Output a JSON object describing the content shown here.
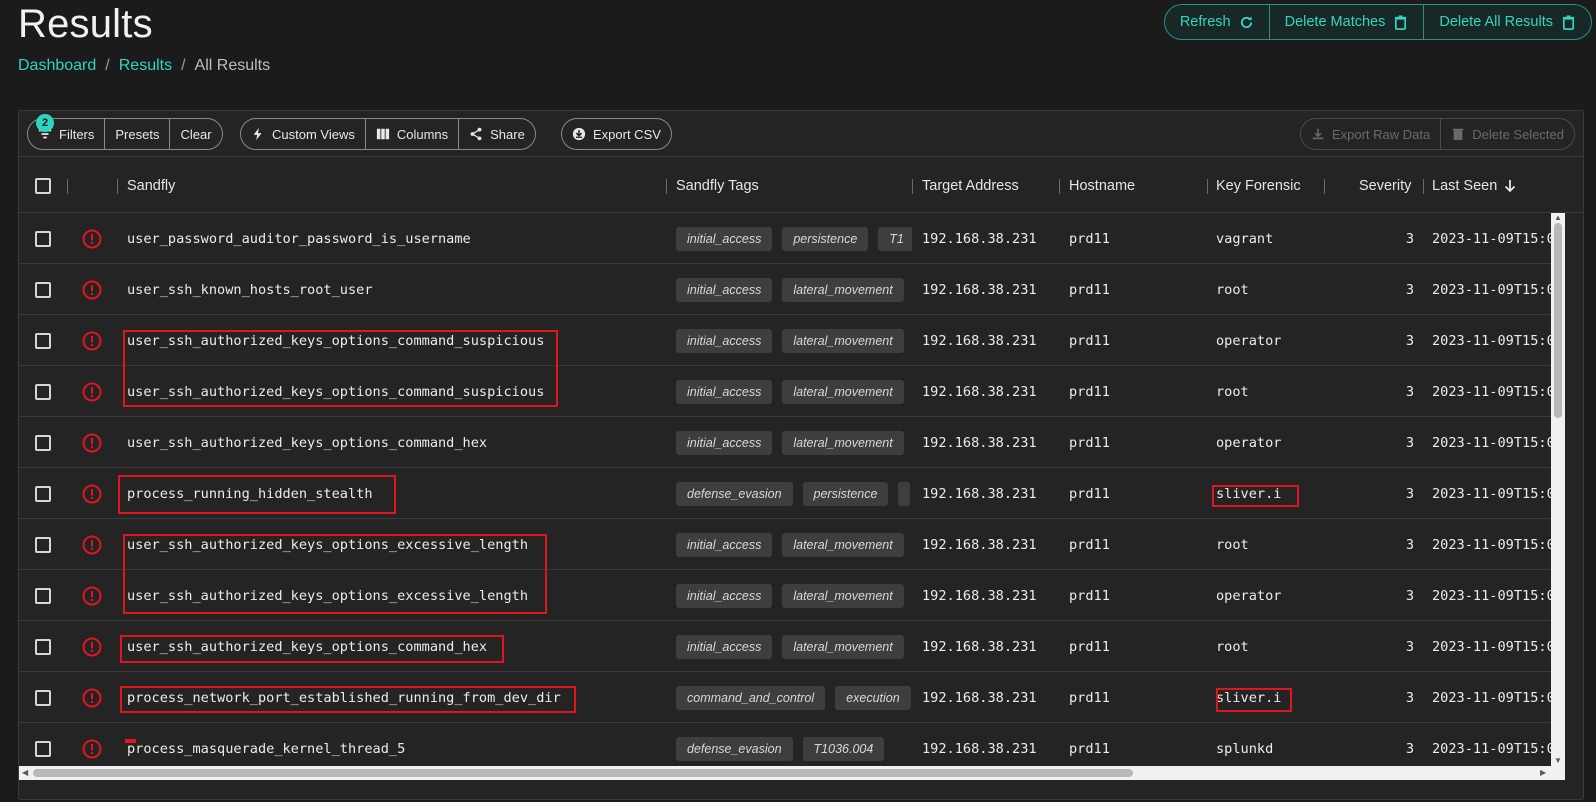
{
  "page": {
    "title": "Results"
  },
  "breadcrumb": [
    {
      "label": "Dashboard"
    },
    {
      "label": "Results"
    },
    {
      "label": "All Results"
    }
  ],
  "breadcrumb_sep": "/",
  "top_actions": {
    "refresh": "Refresh",
    "delete_matches": "Delete Matches",
    "delete_all": "Delete All Results"
  },
  "toolbar": {
    "filters": "Filters",
    "filters_badge": "2",
    "presets": "Presets",
    "clear": "Clear",
    "custom_views": "Custom Views",
    "columns": "Columns",
    "share": "Share",
    "export_csv": "Export CSV",
    "export_raw": "Export Raw Data",
    "delete_selected": "Delete Selected"
  },
  "columns": {
    "sandfly": "Sandfly",
    "tags": "Sandfly Tags",
    "target": "Target Address",
    "hostname": "Hostname",
    "key_forensic": "Key Forensic",
    "severity": "Severity",
    "last_seen": "Last Seen"
  },
  "colors": {
    "accent": "#2fd4be",
    "alert": "#e0161f",
    "highlight": "#e0161f"
  },
  "rows": [
    {
      "sandfly": "user_password_auditor_password_is_username",
      "tags": [
        "initial_access",
        "persistence",
        "T1"
      ],
      "target": "192.168.38.231",
      "hostname": "prd11",
      "forensic": "vagrant",
      "severity": "3",
      "last_seen": "2023-11-09T15:0"
    },
    {
      "sandfly": "user_ssh_known_hosts_root_user",
      "tags": [
        "initial_access",
        "lateral_movement"
      ],
      "target": "192.168.38.231",
      "hostname": "prd11",
      "forensic": "root",
      "severity": "3",
      "last_seen": "2023-11-09T15:0"
    },
    {
      "sandfly": "user_ssh_authorized_keys_options_command_suspicious",
      "tags": [
        "initial_access",
        "lateral_movement"
      ],
      "target": "192.168.38.231",
      "hostname": "prd11",
      "forensic": "operator",
      "severity": "3",
      "last_seen": "2023-11-09T15:0"
    },
    {
      "sandfly": "user_ssh_authorized_keys_options_command_suspicious",
      "tags": [
        "initial_access",
        "lateral_movement"
      ],
      "target": "192.168.38.231",
      "hostname": "prd11",
      "forensic": "root",
      "severity": "3",
      "last_seen": "2023-11-09T15:0"
    },
    {
      "sandfly": "user_ssh_authorized_keys_options_command_hex",
      "tags": [
        "initial_access",
        "lateral_movement"
      ],
      "target": "192.168.38.231",
      "hostname": "prd11",
      "forensic": "operator",
      "severity": "3",
      "last_seen": "2023-11-09T15:0"
    },
    {
      "sandfly": "process_running_hidden_stealth",
      "tags": [
        "defense_evasion",
        "persistence",
        ""
      ],
      "target": "192.168.38.231",
      "hostname": "prd11",
      "forensic": "sliver.i",
      "severity": "3",
      "last_seen": "2023-11-09T15:0"
    },
    {
      "sandfly": "user_ssh_authorized_keys_options_excessive_length",
      "tags": [
        "initial_access",
        "lateral_movement"
      ],
      "target": "192.168.38.231",
      "hostname": "prd11",
      "forensic": "root",
      "severity": "3",
      "last_seen": "2023-11-09T15:0"
    },
    {
      "sandfly": "user_ssh_authorized_keys_options_excessive_length",
      "tags": [
        "initial_access",
        "lateral_movement"
      ],
      "target": "192.168.38.231",
      "hostname": "prd11",
      "forensic": "operator",
      "severity": "3",
      "last_seen": "2023-11-09T15:0"
    },
    {
      "sandfly": "user_ssh_authorized_keys_options_command_hex",
      "tags": [
        "initial_access",
        "lateral_movement"
      ],
      "target": "192.168.38.231",
      "hostname": "prd11",
      "forensic": "root",
      "severity": "3",
      "last_seen": "2023-11-09T15:0"
    },
    {
      "sandfly": "process_network_port_established_running_from_dev_dir",
      "tags": [
        "command_and_control",
        "execution"
      ],
      "target": "192.168.38.231",
      "hostname": "prd11",
      "forensic": "sliver.i",
      "severity": "3",
      "last_seen": "2023-11-09T15:0"
    },
    {
      "sandfly": "process_masquerade_kernel_thread_5",
      "tags": [
        "defense_evasion",
        "T1036.004"
      ],
      "target": "192.168.38.231",
      "hostname": "prd11",
      "forensic": "splunkd",
      "severity": "3",
      "last_seen": "2023-11-09T15:0"
    }
  ]
}
